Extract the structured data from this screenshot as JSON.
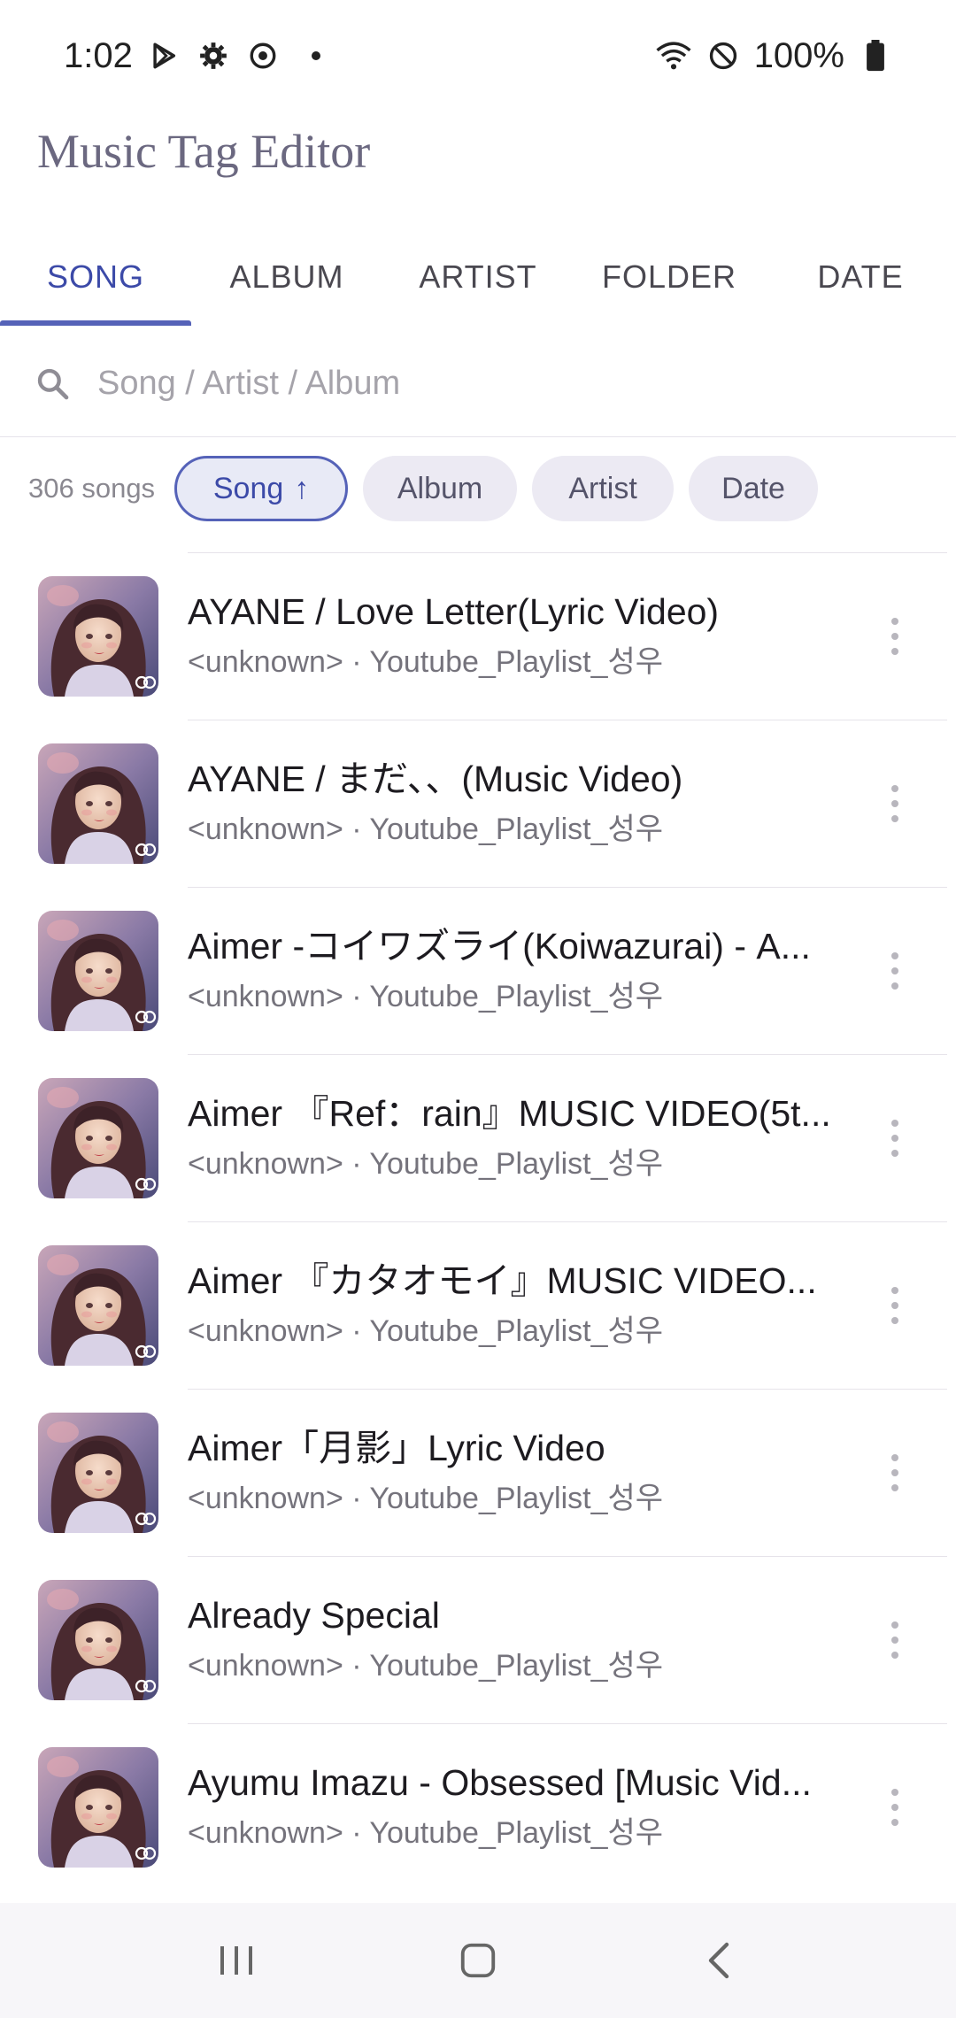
{
  "status_bar": {
    "time": "1:02",
    "battery": "100%",
    "icons": [
      "play-store-icon",
      "gear-icon",
      "sync-icon",
      "dot-icon",
      "wifi-icon",
      "dnd-icon",
      "battery-icon"
    ]
  },
  "app": {
    "title": "Music Tag Editor"
  },
  "tabs": [
    {
      "label": "SONG",
      "active": true
    },
    {
      "label": "ALBUM",
      "active": false
    },
    {
      "label": "ARTIST",
      "active": false
    },
    {
      "label": "FOLDER",
      "active": false
    },
    {
      "label": "DATE",
      "active": false
    }
  ],
  "search": {
    "placeholder": "Song / Artist / Album",
    "value": ""
  },
  "filter": {
    "count": "306 songs",
    "chips": [
      {
        "label": "Song",
        "arrow": "↑",
        "active": true
      },
      {
        "label": "Album"
      },
      {
        "label": "Artist"
      },
      {
        "label": "Date"
      }
    ]
  },
  "songs": [
    {
      "title": "AYANE / Love Letter(Lyric Video)",
      "subtitle": "<unknown> · Youtube_Playlist_성우"
    },
    {
      "title": "AYANE / まだ、、(Music Video)",
      "subtitle": "<unknown> · Youtube_Playlist_성우"
    },
    {
      "title": "Aimer -コイワズライ(Koiwazurai) - A...",
      "subtitle": "<unknown> · Youtube_Playlist_성우"
    },
    {
      "title": "Aimer 『Ref：rain』MUSIC VIDEO(5t...",
      "subtitle": "<unknown> · Youtube_Playlist_성우"
    },
    {
      "title": "Aimer 『カタオモイ』MUSIC VIDEO...",
      "subtitle": "<unknown> · Youtube_Playlist_성우"
    },
    {
      "title": "Aimer「月影」Lyric Video",
      "subtitle": "<unknown> · Youtube_Playlist_성우"
    },
    {
      "title": "Already Special",
      "subtitle": "<unknown> · Youtube_Playlist_성우"
    },
    {
      "title": "Ayumu Imazu - Obsessed [Music Vid...",
      "subtitle": "<unknown> · Youtube_Playlist_성우"
    }
  ],
  "nav": {
    "icons": [
      "recents-icon",
      "home-icon",
      "back-icon"
    ]
  },
  "colors": {
    "accent": "#5562b8",
    "accent_text": "#3c4aa8",
    "chip_bg": "#eceaf3"
  }
}
